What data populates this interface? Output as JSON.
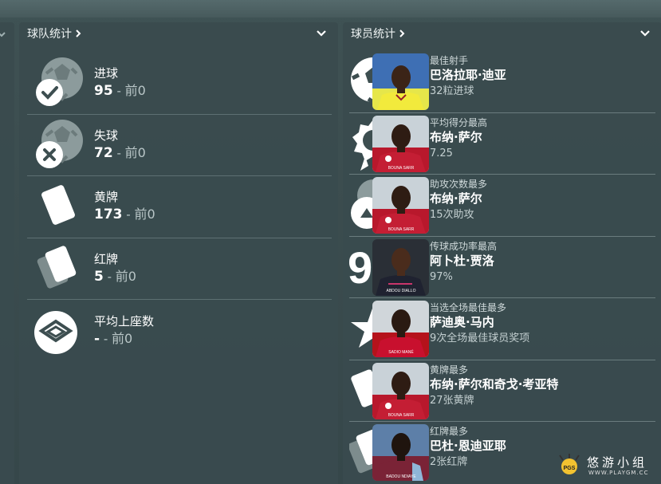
{
  "team_panel": {
    "title": "球队统计",
    "stats": [
      {
        "icon": "ball-check-icon",
        "label": "进球",
        "value": "95",
        "separator": " - ",
        "rank": "前0"
      },
      {
        "icon": "ball-x-icon",
        "label": "失球",
        "value": "72",
        "separator": " - ",
        "rank": "前0"
      },
      {
        "icon": "yellow-card-icon",
        "label": "黄牌",
        "value": "173",
        "separator": " - ",
        "rank": "前0"
      },
      {
        "icon": "red-card-icon",
        "label": "红牌",
        "value": "5",
        "separator": " - ",
        "rank": "前0"
      },
      {
        "icon": "stadium-seat-icon",
        "label": "平均上座数",
        "value": "-",
        "separator": " - ",
        "rank": "前0"
      }
    ]
  },
  "player_panel": {
    "title": "球员统计",
    "leaders": [
      {
        "icon": "ball-icon",
        "category": "最佳射手",
        "name": "巴洛拉耶·迪亚",
        "detail": "32粒进球",
        "kit": "yellow",
        "jersey_text": ""
      },
      {
        "icon": "rating-badge-icon",
        "category": "平均得分最高",
        "name": "布纳·萨尔",
        "detail": "7.25",
        "kit": "red",
        "jersey_text": "BOUNA SARR"
      },
      {
        "icon": "assist-icon",
        "category": "助攻次数最多",
        "name": "布纳·萨尔",
        "detail": "15次助攻",
        "kit": "red",
        "jersey_text": "BOUNA SARR"
      },
      {
        "icon": "pass-percent-icon",
        "category": "传球成功率最高",
        "name": "阿卜杜·贾洛",
        "detail": "97%",
        "kit": "dark",
        "jersey_text": "ABDOU DIALLO"
      },
      {
        "icon": "star-icon",
        "category": "当选全场最佳最多",
        "name": "萨迪奥·马内",
        "detail": "9次全场最佳球员奖项",
        "kit": "red",
        "jersey_text": "SADIO MANÉ"
      },
      {
        "icon": "yellow-card-icon",
        "category": "黄牌最多",
        "name": "布纳·萨尔和奇戈·考亚特",
        "detail": "27张黄牌",
        "kit": "red",
        "jersey_text": "BOUNA SARR"
      },
      {
        "icon": "red-card-icon",
        "category": "红牌最多",
        "name": "巴杜·恩迪亚耶",
        "detail": "2张红牌",
        "kit": "claret",
        "jersey_text": "BADOU NDIAYE"
      }
    ]
  },
  "watermark": {
    "text": "悠游小组",
    "url": "WWW.PLAYGM.CC",
    "logo": "PGS"
  },
  "colors": {
    "panel": "#3a4b4e",
    "divider": "#5d7072",
    "muted_text": "#b9c6c7"
  }
}
